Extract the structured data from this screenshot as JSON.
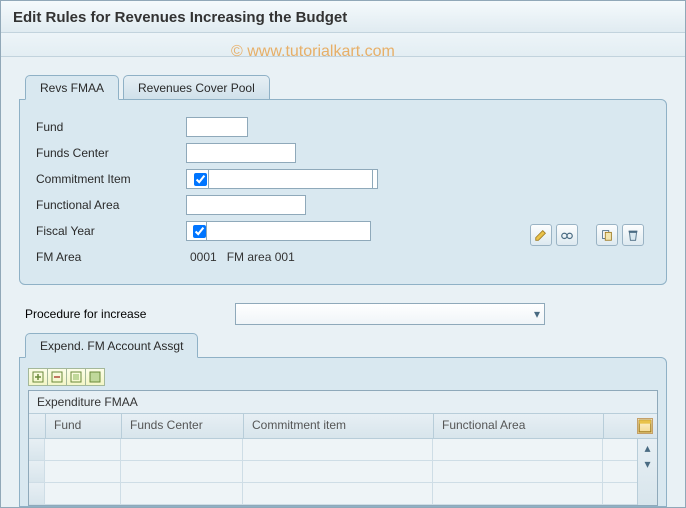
{
  "title": "Edit Rules for Revenues Increasing the Budget",
  "watermark": "© www.tutorialkart.com",
  "tabs": {
    "active": "Revs FMAA",
    "other": "Revenues Cover Pool"
  },
  "form": {
    "fund_label": "Fund",
    "fund_value": "",
    "funds_center_label": "Funds Center",
    "funds_center_value": "",
    "commitment_item_label": "Commitment Item",
    "commitment_item_value": "",
    "commitment_item_checked": true,
    "functional_area_label": "Functional Area",
    "functional_area_value": "",
    "fiscal_year_label": "Fiscal Year",
    "fiscal_year_value": "",
    "fiscal_year_checked": true,
    "fm_area_label": "FM Area",
    "fm_area_code": "0001",
    "fm_area_desc": "FM area 001"
  },
  "icons": {
    "edit": "edit-pencil",
    "glasses": "display-glasses",
    "copy": "copy",
    "delete": "delete-trash"
  },
  "procedure": {
    "label": "Procedure for increase",
    "value": ""
  },
  "sub_tab": "Expend. FM Account Assgt",
  "grid": {
    "title": "Expenditure FMAA",
    "columns": [
      "Fund",
      "Funds Center",
      "Commitment item",
      "Functional Area"
    ]
  }
}
